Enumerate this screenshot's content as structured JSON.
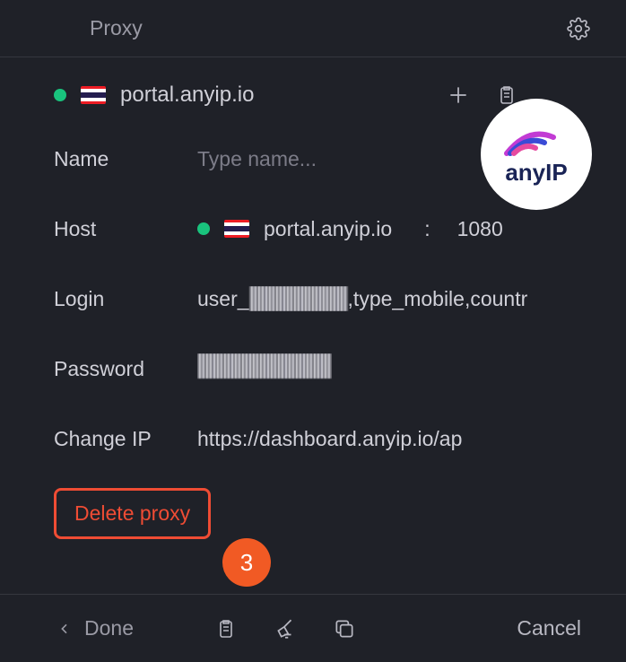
{
  "header": {
    "title": "Proxy"
  },
  "proxy": {
    "host_display": "portal.anyip.io",
    "logo_text": "anyIP"
  },
  "fields": {
    "name": {
      "label": "Name",
      "placeholder": "Type name..."
    },
    "host": {
      "label": "Host",
      "value": "portal.anyip.io",
      "port_separator": ":",
      "port": "1080"
    },
    "login": {
      "label": "Login",
      "value_prefix": "user_",
      "value_suffix": ",type_mobile,countr"
    },
    "password": {
      "label": "Password"
    },
    "change_ip": {
      "label": "Change IP",
      "value": "https://dashboard.anyip.io/ap"
    }
  },
  "actions": {
    "delete": "Delete proxy",
    "done": "Done",
    "cancel": "Cancel"
  },
  "annotation": {
    "step": "3"
  },
  "colors": {
    "accent_orange": "#f15a24",
    "danger": "#ef4c34",
    "status_green": "#19c37d",
    "bg": "#1f2128"
  }
}
